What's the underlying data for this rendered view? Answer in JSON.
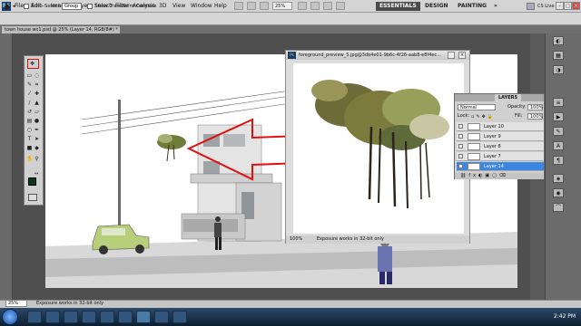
{
  "menubar": {
    "logo": "PS",
    "items": [
      "File",
      "Edit",
      "Image",
      "Layer",
      "Select",
      "Filter",
      "Analysis",
      "3D",
      "View",
      "Window",
      "Help"
    ],
    "zoom": "25%",
    "workspaces": [
      "ESSENTIALS",
      "DESIGN",
      "PAINTING"
    ],
    "more": "»",
    "cs_live": "CS Live"
  },
  "options": {
    "auto_select_label": "Auto-Select:",
    "auto_select_value": "Group",
    "transform_label": "Show Transform Controls"
  },
  "document": {
    "tab_title": "town house wc1.psd @ 25% (Layer 14, RGB/8#) *"
  },
  "secondary_doc": {
    "title": "foreground_preview_5.jpg@3db4e01-9b6c-4f26-aab8-e8f4ec...",
    "zoom": "100%",
    "status": "Exposure works in 32-bit only"
  },
  "layers_panel": {
    "tab": "LAYERS",
    "blend_mode": "Normal",
    "opacity_label": "Opacity:",
    "opacity_value": "100%",
    "lock_label": "Lock:",
    "fill_label": "Fill:",
    "fill_value": "100%",
    "layers": [
      {
        "name": "Layer 10",
        "selected": false
      },
      {
        "name": "Layer 9",
        "selected": false
      },
      {
        "name": "Layer 8",
        "selected": false
      },
      {
        "name": "Layer 7",
        "selected": false
      },
      {
        "name": "Layer 14",
        "selected": true
      }
    ]
  },
  "statusbar": {
    "zoom": "25%",
    "text": "Exposure works in 32-bit only"
  },
  "taskbar": {
    "time": "2:42 PM"
  },
  "colors": {
    "highlight_red": "#e01010",
    "layer_selected": "#3a86e0",
    "foreground_color": "#0a3a1a"
  }
}
